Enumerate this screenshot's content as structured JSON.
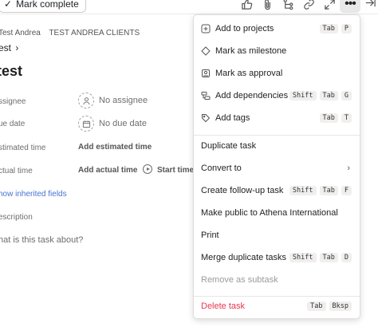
{
  "toolbar": {
    "mark_complete": "Mark complete",
    "icons": [
      "thumbs-up-icon",
      "paperclip-icon",
      "subtask-icon",
      "link-icon",
      "expand-icon",
      "more-icon",
      "close-panel-icon"
    ]
  },
  "breadcrumb": {
    "items": [
      "Test Andrea",
      "TEST ANDREA CLIENTS"
    ],
    "parent": "est"
  },
  "task": {
    "title": "test"
  },
  "fields": {
    "assignee_label": "ssignee",
    "assignee_value": "No assignee",
    "due_label": "ue date",
    "due_value": "No due date",
    "estimated_label": "stimated time",
    "estimated_action": "Add estimated time",
    "actual_label": "ctual time",
    "actual_action": "Add actual time",
    "timer_action": "Start timer",
    "show_inherited": "how inherited fields",
    "description_label": "escription",
    "description_placeholder": "hat is this task about?"
  },
  "menu": {
    "items": [
      {
        "label": "Add to projects",
        "keys": [
          "Tab",
          "P"
        ]
      },
      {
        "label": "Mark as milestone",
        "keys": []
      },
      {
        "label": "Mark as approval",
        "keys": []
      },
      {
        "label": "Add dependencies",
        "keys": [
          "Shift",
          "Tab",
          "G"
        ]
      },
      {
        "label": "Add tags",
        "keys": [
          "Tab",
          "T"
        ]
      },
      {
        "label": "Duplicate task",
        "keys": []
      },
      {
        "label": "Convert to",
        "keys": []
      },
      {
        "label": "Create follow-up task",
        "keys": [
          "Shift",
          "Tab",
          "F"
        ]
      },
      {
        "label": "Make public to Athena International",
        "keys": []
      },
      {
        "label": "Print",
        "keys": []
      },
      {
        "label": "Merge duplicate tasks",
        "keys": [
          "Shift",
          "Tab",
          "D"
        ]
      },
      {
        "label": "Remove as subtask",
        "keys": []
      },
      {
        "label": "Delete task",
        "keys": [
          "Tab",
          "Bksp"
        ]
      }
    ]
  },
  "colors": {
    "accent_link": "#4573d2",
    "danger": "#e8384f",
    "highlight": "#f7f59a"
  }
}
